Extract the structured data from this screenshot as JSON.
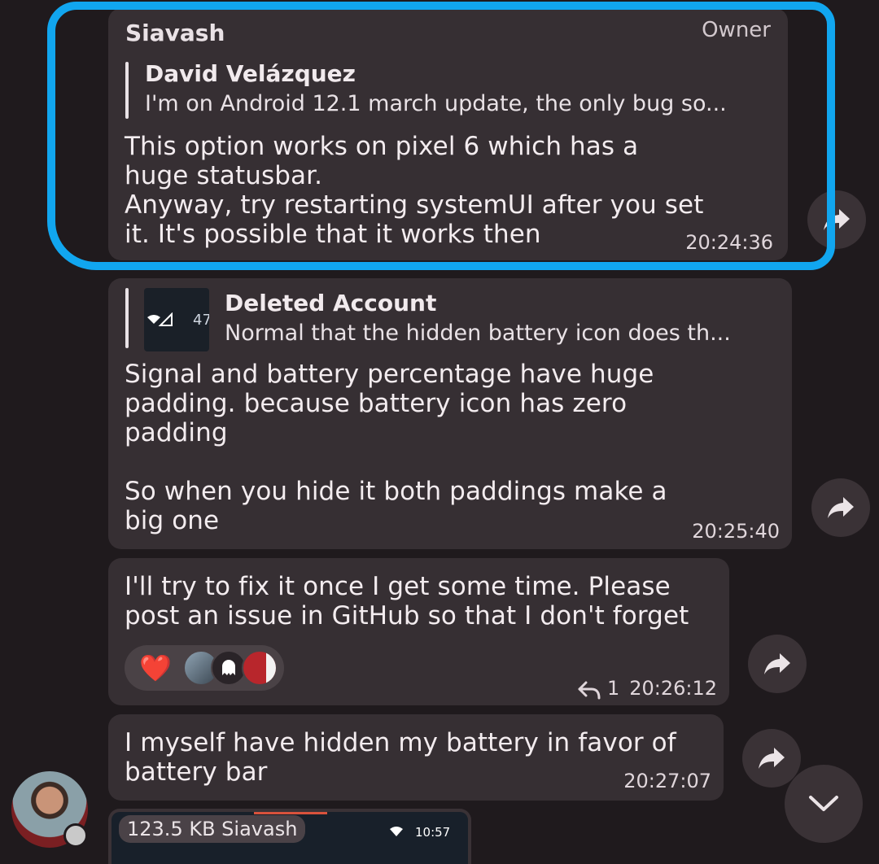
{
  "messages": [
    {
      "sender": "Siavash",
      "role": "Owner",
      "reply": {
        "name": "David Velázquez",
        "text": "I'm on Android 12.1 march update, the only bug so..."
      },
      "text": "This option works on pixel 6 which has a\nhuge statusbar.\nAnyway, try restarting systemUI after you set\nit. It's possible that it works then",
      "time": "20:24:36"
    },
    {
      "reply": {
        "name": "Deleted Account",
        "text": "Normal that the hidden battery icon does th...",
        "thumb_text": "47"
      },
      "text": "Signal and battery percentage have huge\npadding. because battery icon has zero\npadding\n\nSo when you hide it both paddings make a\nbig one",
      "time": "20:25:40"
    },
    {
      "text": "I'll try to fix it once I get some time. Please\npost an issue in GitHub so that I don't forget",
      "reaction_emoji": "❤️",
      "reply_count": "1",
      "time": "20:26:12"
    },
    {
      "text": "I myself have hidden my battery in favor of\nbattery bar",
      "time": "20:27:07"
    },
    {
      "file_label": "123.5 KB Siavash",
      "preview_time": "10:57"
    }
  ],
  "colors": {
    "background": "#1f1a1d",
    "bubble": "#362f33",
    "highlight": "#11a6ef",
    "reaction_heart": "#e0242e"
  },
  "icons": {
    "forward": "forward-arrow-icon",
    "scroll_down": "chevron-down-icon",
    "reply_count": "reply-arrow-icon"
  }
}
